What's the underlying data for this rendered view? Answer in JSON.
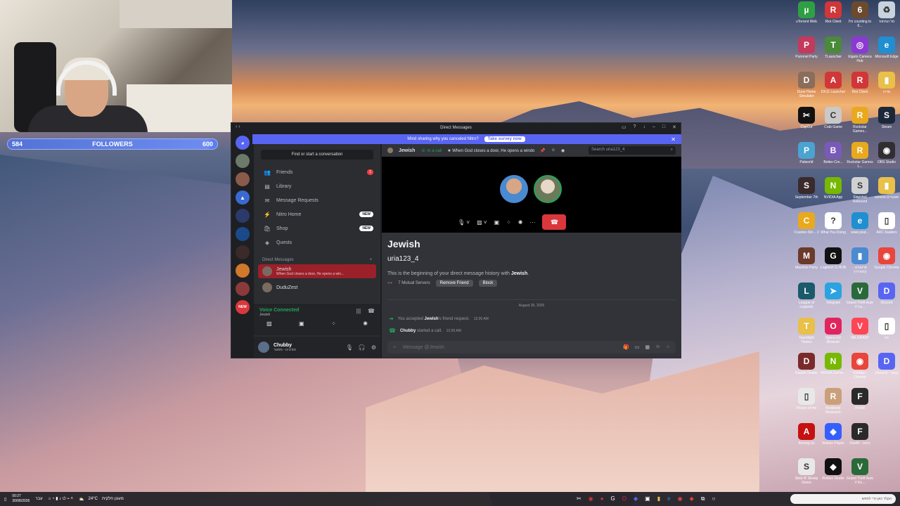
{
  "stream": {
    "followers_label": "FOLLOWERS",
    "followers_current": "584",
    "followers_goal": "600",
    "followers_progress": 0.973
  },
  "desktop_icons": [
    {
      "label": "uTorrent Web",
      "icon": "utorrent-icon",
      "color": "#2ea043",
      "glyph": "µ"
    },
    {
      "label": "Riot Client",
      "icon": "riot-icon",
      "color": "#d13639",
      "glyph": "R"
    },
    {
      "label": "I'm counting to 6...",
      "icon": "game-icon",
      "color": "#6b4a2e",
      "glyph": "6"
    },
    {
      "label": "סל המחזור",
      "icon": "recycle-bin-icon",
      "color": "#c9d3de",
      "glyph": "♻"
    },
    {
      "label": "Pummel Party",
      "icon": "pummel-icon",
      "color": "#c43a5c",
      "glyph": "P"
    },
    {
      "label": "TLauncher",
      "icon": "tlauncher-icon",
      "color": "#4a8a3a",
      "glyph": "T"
    },
    {
      "label": "Elgato Camera Hub",
      "icon": "elgato-icon",
      "color": "#8a3ad1",
      "glyph": "◎"
    },
    {
      "label": "Microsoft Edge",
      "icon": "edge-icon",
      "color": "#1f8fd1",
      "glyph": "e"
    },
    {
      "label": "Dune Home Simulator",
      "icon": "sim-icon",
      "color": "#8a6d5a",
      "glyph": "D"
    },
    {
      "label": "DX11 Launcher",
      "icon": "launcher-icon",
      "color": "#d13639",
      "glyph": "A"
    },
    {
      "label": "Riot Client",
      "icon": "riot-icon",
      "color": "#d13639",
      "glyph": "R"
    },
    {
      "label": "מדיה",
      "icon": "folder-icon",
      "color": "#e8c04a",
      "glyph": "▮"
    },
    {
      "label": "CapCut",
      "icon": "capcut-icon",
      "color": "#111111",
      "glyph": "✂"
    },
    {
      "label": "Crab Game",
      "icon": "crab-icon",
      "color": "#c9c9c9",
      "glyph": "C"
    },
    {
      "label": "Rockstar Games...",
      "icon": "rockstar-icon",
      "color": "#e8a91e",
      "glyph": "R"
    },
    {
      "label": "Steam",
      "icon": "steam-icon",
      "color": "#1b2838",
      "glyph": "S"
    },
    {
      "label": "Palworld",
      "icon": "palworld-icon",
      "color": "#4aa3d1",
      "glyph": "P"
    },
    {
      "label": "Better-Cre...",
      "icon": "app-icon",
      "color": "#7a5ab8",
      "glyph": "B"
    },
    {
      "label": "Rockstar Games L...",
      "icon": "rockstar-icon",
      "color": "#e8a91e",
      "glyph": "R"
    },
    {
      "label": "OBS Studio",
      "icon": "obs-icon",
      "color": "#302e31",
      "glyph": "◉"
    },
    {
      "label": "September 7th",
      "icon": "game-icon",
      "color": "#3a2a2a",
      "glyph": "S"
    },
    {
      "label": "NVIDIA App",
      "icon": "nvidia-icon",
      "color": "#76b900",
      "glyph": "N"
    },
    {
      "label": "Slapshot Rebound",
      "icon": "slapshot-icon",
      "color": "#d1d1d1",
      "glyph": "S"
    },
    {
      "label": "סאונדים אספסט",
      "icon": "folder-icon",
      "color": "#e8c04a",
      "glyph": "▮"
    },
    {
      "label": "Counter-Stri... 2",
      "icon": "cs2-icon",
      "color": "#e8a91e",
      "glyph": "C"
    },
    {
      "label": "What You Doing",
      "icon": "question-icon",
      "color": "#ffffff",
      "glyph": "?"
    },
    {
      "label": "www.yout...",
      "icon": "edge-icon",
      "color": "#1f8fd1",
      "glyph": "e"
    },
    {
      "label": "ARC Raiders",
      "icon": "file-icon",
      "color": "#ffffff",
      "glyph": "▯"
    },
    {
      "label": "Machine Party",
      "icon": "game-icon",
      "color": "#6b3a2a",
      "glyph": "M"
    },
    {
      "label": "Logitech G HUB",
      "icon": "logitech-icon",
      "color": "#111111",
      "glyph": "G"
    },
    {
      "label": "סרטונים - קיצורדרך",
      "icon": "folder-icon",
      "color": "#4a8ad1",
      "glyph": "▮"
    },
    {
      "label": "Google Chrome",
      "icon": "chrome-icon",
      "color": "#e8453c",
      "glyph": "◉"
    },
    {
      "label": "League of Legends",
      "icon": "lol-icon",
      "color": "#1a5a6a",
      "glyph": "L"
    },
    {
      "label": "Telegram",
      "icon": "telegram-icon",
      "color": "#2aa3e0",
      "glyph": "➤"
    },
    {
      "label": "Grand Theft Auto V Le...",
      "icon": "gta-icon",
      "color": "#2a6a3a",
      "glyph": "V"
    },
    {
      "label": "Discord",
      "icon": "discord-icon",
      "color": "#5865f2",
      "glyph": "D"
    },
    {
      "label": "Teamfight Tactics",
      "icon": "tft-icon",
      "color": "#e8c04a",
      "glyph": "T"
    },
    {
      "label": "Opera GX Browser",
      "icon": "opera-icon",
      "color": "#e0245e",
      "glyph": "O"
    },
    {
      "label": "VALORANT",
      "icon": "valorant-icon",
      "color": "#ff4655",
      "glyph": "V"
    },
    {
      "label": "סל",
      "icon": "file-icon",
      "color": "#ffffff",
      "glyph": "▯"
    },
    {
      "label": "Double Dealer",
      "icon": "game-icon",
      "color": "#7a2a2a",
      "glyph": "D"
    },
    {
      "label": "NVIDIA GeFor...",
      "icon": "nvidia-icon",
      "color": "#76b900",
      "glyph": "N"
    },
    {
      "label": "Chubby - Chrome",
      "icon": "chrome-icon",
      "color": "#e8453c",
      "glyph": "◉"
    },
    {
      "label": "Discord - קיצור",
      "icon": "discord-icon",
      "color": "#5865f2",
      "glyph": "D"
    },
    {
      "label": "Pieces of me",
      "icon": "file-icon",
      "color": "#e8e8e8",
      "glyph": "▯"
    },
    {
      "label": "Roadside Research",
      "icon": "game-icon",
      "color": "#c9a07a",
      "glyph": "R"
    },
    {
      "label": "FiveM",
      "icon": "fivem-icon",
      "color": "#2a2a2a",
      "glyph": "F"
    },
    {
      "label": "",
      "icon": "",
      "color": "transparent",
      "glyph": ""
    },
    {
      "label": "Among Us",
      "icon": "amongus-icon",
      "color": "#c51111",
      "glyph": "A"
    },
    {
      "label": "Roblox Player",
      "icon": "roblox-icon",
      "color": "#335fff",
      "glyph": "◆"
    },
    {
      "label": "FiveM - גרסה",
      "icon": "fivem-icon",
      "color": "#2a2a2a",
      "glyph": "F"
    },
    {
      "label": "",
      "icon": "",
      "color": "transparent",
      "glyph": ""
    },
    {
      "label": "Stick N' Sheep Demo",
      "icon": "sheep-icon",
      "color": "#e8e8e8",
      "glyph": "S"
    },
    {
      "label": "Roblox Studio",
      "icon": "roblox-icon",
      "color": "#111111",
      "glyph": "◆"
    },
    {
      "label": "Grand Theft Auto V En...",
      "icon": "gta-icon",
      "color": "#2a6a3a",
      "glyph": "V"
    }
  ],
  "discord": {
    "window_title": "Direct Messages",
    "banner": {
      "text": "Mind sharing why you canceled Nitro?",
      "button": "Take survey now"
    },
    "find_conversation": "Find or start a conversation",
    "nav": [
      {
        "label": "Friends",
        "icon": "friends-icon",
        "glyph": "👥",
        "badge": "1"
      },
      {
        "label": "Library",
        "icon": "library-icon",
        "glyph": "▤",
        "badge": ""
      },
      {
        "label": "Message Requests",
        "icon": "message-requests-icon",
        "glyph": "✉",
        "badge": ""
      },
      {
        "label": "Nitro Home",
        "icon": "nitro-icon",
        "glyph": "⚡",
        "badge_new": "NEW"
      },
      {
        "label": "Shop",
        "icon": "shop-icon",
        "glyph": "🛍",
        "badge_new": "NEW"
      },
      {
        "label": "Quests",
        "icon": "quests-icon",
        "glyph": "◈",
        "badge": ""
      }
    ],
    "dm_header": "Direct Messages",
    "dms": [
      {
        "name": "Jewish",
        "status": "When God closes a door, He opens a win...",
        "active": true
      },
      {
        "name": "DuduZest",
        "status": "",
        "active": false
      }
    ],
    "voice": {
      "status": "Voice Connected",
      "channel": "Jewish"
    },
    "user": {
      "name": "Chubby",
      "status": "סורבינו - מסטר"
    },
    "chat": {
      "name": "Jewish",
      "call_status": "In a call",
      "custom_status": "When God closes a door, He opens a windo",
      "search_placeholder": "Search uria123_4",
      "display_name": "Jewish",
      "username": "uria123_4",
      "intro_prefix": "This is the beginning of your direct message history with ",
      "intro_name": "Jewish",
      "intro_suffix": ".",
      "mutual_servers": "7 Mutual Servers",
      "remove_friend": "Remove Friend",
      "block": "Block",
      "date_divider": "August 30, 2026",
      "events": [
        {
          "prefix": "You accepted ",
          "who": "Jewish",
          "suffix": "'s friend request.",
          "time": "12:26 AM"
        },
        {
          "prefix": "",
          "who": "Chubby",
          "suffix": " started a call.",
          "time": "12:26 AM"
        }
      ],
      "composer_placeholder": "Message @Jewish"
    }
  },
  "taskbar": {
    "time": "00:27",
    "date": "30/08/2026",
    "language": "עבר",
    "weather_temp": "24°C",
    "weather_text": "מעונן חלקית",
    "search_placeholder": "הקלד כאן כדי לחפש"
  },
  "colors": {
    "discord_blurple": "#5865f2",
    "online_green": "#23a55a",
    "danger_red": "#da373c"
  }
}
